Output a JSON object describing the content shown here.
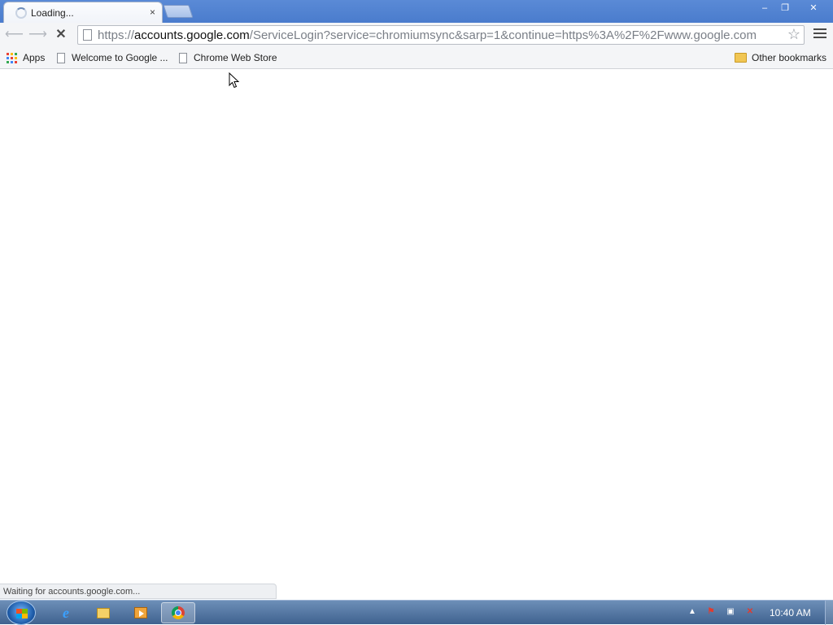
{
  "tab": {
    "title": "Loading...",
    "close_glyph": "×"
  },
  "window_controls": {
    "minimize": "‒",
    "maximize": "❐",
    "close": "✕"
  },
  "toolbar": {
    "back_glyph": "⟵",
    "forward_glyph": "⟶",
    "stop_glyph": "✕",
    "url_scheme": "https://",
    "url_host": "accounts.google.com",
    "url_rest": "/ServiceLogin?service=chromiumsync&sarp=1&continue=https%3A%2F%2Fwww.google.com",
    "star_glyph": "☆"
  },
  "bookmarks": {
    "apps": "Apps",
    "welcome": "Welcome to Google ...",
    "store": "Chrome Web Store",
    "other": "Other bookmarks"
  },
  "status": {
    "text": "Waiting for accounts.google.com..."
  },
  "taskbar": {
    "apps": [
      "internet-explorer",
      "windows-explorer",
      "media-player",
      "chrome"
    ],
    "ie_glyph": "e",
    "tray_up": "▲",
    "clock": "10:40 AM"
  },
  "colors": {
    "apps_grid": [
      "#e94235",
      "#fbbc04",
      "#34a853",
      "#4285f4",
      "#e94235",
      "#fbbc04",
      "#34a853",
      "#4285f4",
      "#e94235"
    ]
  }
}
